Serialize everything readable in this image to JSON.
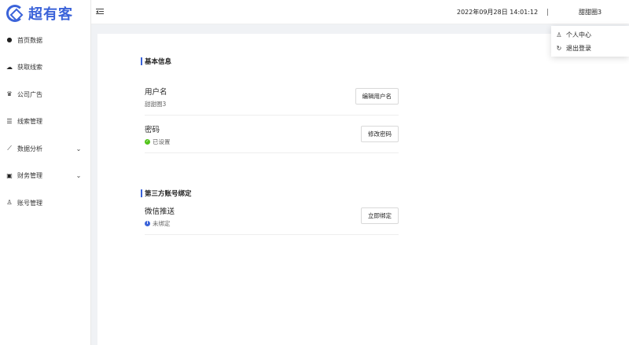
{
  "brand": {
    "name": "超有客",
    "accent": "#3b63d9"
  },
  "sidebar": {
    "items": [
      {
        "label": "首页数据",
        "icon": "dashboard-icon"
      },
      {
        "label": "获取线索",
        "icon": "cloud-icon"
      },
      {
        "label": "公司广告",
        "icon": "crown-icon"
      },
      {
        "label": "线索管理",
        "icon": "database-icon"
      },
      {
        "label": "数据分析",
        "icon": "line-chart-icon",
        "expandable": true
      },
      {
        "label": "财务管理",
        "icon": "money-icon",
        "expandable": true
      },
      {
        "label": "账号管理",
        "icon": "user-icon"
      }
    ]
  },
  "header": {
    "datetime": "2022年09月28日 14:01:12",
    "username": "甜甜圈3"
  },
  "user_menu": {
    "items": [
      {
        "label": "个人中心",
        "icon": "user-icon"
      },
      {
        "label": "退出登录",
        "icon": "logout-icon"
      }
    ]
  },
  "basic_info": {
    "title": "基本信息",
    "username_row": {
      "label": "用户名",
      "value": "甜甜圈3",
      "button": "编辑用户名"
    },
    "password_row": {
      "label": "密码",
      "status": "已设置",
      "button": "修改密码"
    }
  },
  "third_party": {
    "title": "第三方账号绑定",
    "wechat_row": {
      "label": "微信推送",
      "status": "未绑定",
      "button": "立即绑定"
    }
  },
  "colors": {
    "success": "#52c41a",
    "info": "#3b63d9"
  }
}
